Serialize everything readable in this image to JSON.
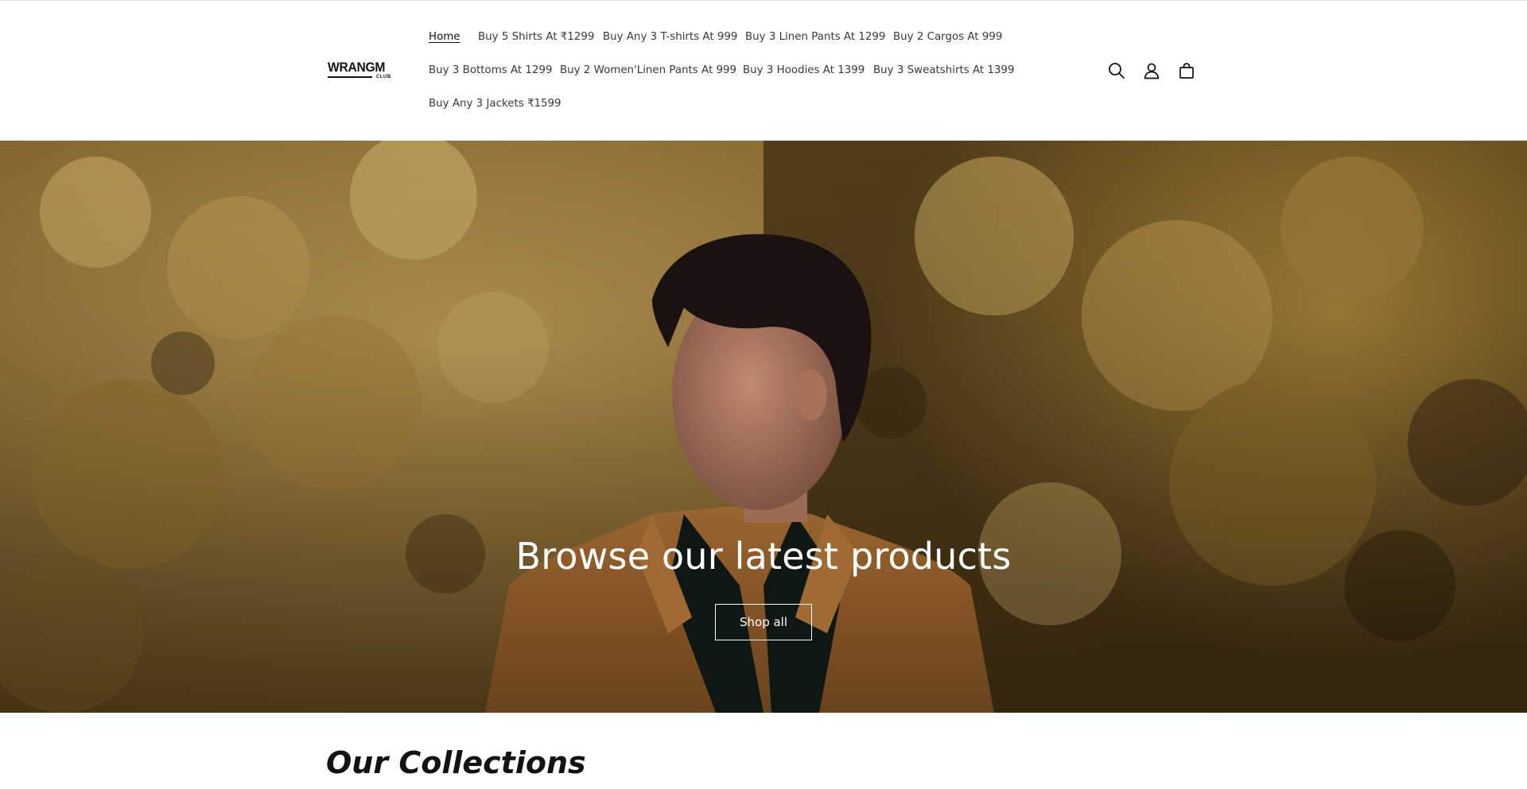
{
  "header": {
    "logo": {
      "text": "WRANGM",
      "subtext": "CLUB"
    },
    "nav": [
      {
        "label": "Home",
        "active": true
      },
      {
        "label": "Buy 5 Shirts At ₹1299"
      },
      {
        "label": "Buy Any 3 T-shirts At 999"
      },
      {
        "label": "Buy 3 Linen Pants At 1299"
      },
      {
        "label": "Buy 2 Cargos At 999"
      },
      {
        "label": "Buy 3 Bottoms At 1299"
      },
      {
        "label": "Buy 2 Women'Linen Pants At 999"
      },
      {
        "label": "Buy 3 Hoodies At 1399"
      },
      {
        "label": "Buy 3 Sweatshirts At 1399"
      },
      {
        "label": "Buy Any 3 Jackets ₹1599"
      }
    ],
    "icons": [
      "search-icon",
      "account-icon",
      "cart-icon"
    ]
  },
  "hero": {
    "heading": "Browse our latest products",
    "button_label": "Shop all"
  },
  "collections": {
    "title": "Our Collections"
  },
  "colors": {
    "text": "#121212",
    "nav_text": "#3a3a3a",
    "hero_foliage": "#b08a40",
    "white": "#ffffff"
  }
}
